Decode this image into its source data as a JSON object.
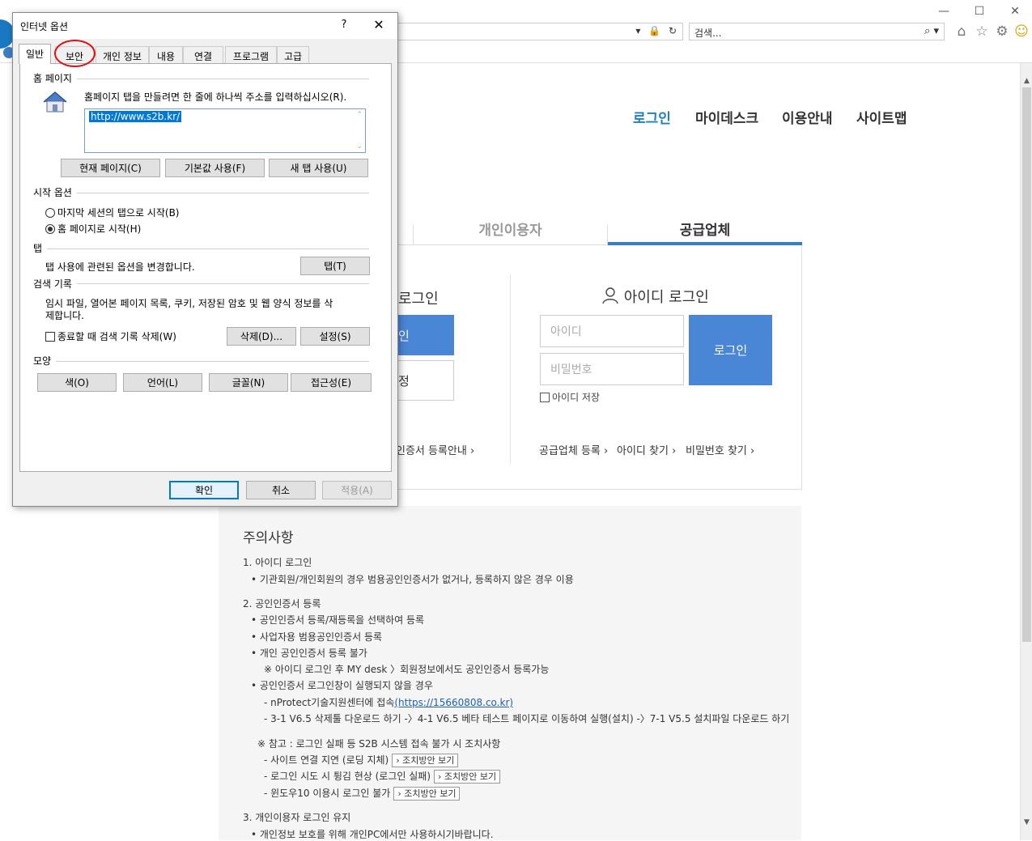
{
  "browser": {
    "window_controls": {
      "minimize": "—",
      "maximize": "☐",
      "close": "✕"
    },
    "address_tools": "▾ 🔒 ↻",
    "search_placeholder": "검색...",
    "search_tools": "⌕ ▾",
    "toolbar_icons": {
      "home": "⌂",
      "favorites": "☆",
      "settings": "⚙",
      "smiley": "☺"
    }
  },
  "page": {
    "nav": [
      "로그인",
      "마이데스크",
      "이용안내",
      "사이트맵"
    ],
    "user_tabs": {
      "personal": "개인이용자",
      "supplier": "공급업체"
    },
    "cert_login": {
      "title_partial": "로그인",
      "login_btn_partial": "인",
      "register_btn_partial": "정",
      "cert_register_link": "인증서 등록안내 ›"
    },
    "id_login": {
      "title": "아이디 로그인",
      "id_placeholder": "아이디",
      "pw_placeholder": "비밀번호",
      "login_button": "로그인",
      "save_id": "아이디 저장",
      "links": [
        "공급업체 등록 ›",
        "아이디 찾기 ›",
        "비밀번호 찾기 ›"
      ]
    },
    "notice": {
      "title": "주의사항",
      "lines": [
        "1. 아이디 로그인",
        "• 기관회원/개인회원의 경우 범용공인인증서가 없거나, 등록하지 않은 경우 이용",
        "2. 공인인증서 등록",
        "• 공인인증서 등록/재등록을 선택하여 등록",
        "• 사업자용 범용공인인증서 등록",
        "• 개인 공인인증서 등록 불가",
        "※ 아이디 로그인 후 MY desk 〉회원정보에서도 공인인증서 등록가능",
        "• 공인인증서 로그인창이 실행되지 않을 경우",
        "- nProtect기술지원센터에 접속",
        "- 3-1 V6.5 삭제툴 다운로드 하기 -〉4-1 V6.5 베타 테스트 페이지로 이동하여 실행(설치) -〉7-1 V5.5 설치파일 다운로드 하기",
        "※ 참고 : 로그인 실패 등 S2B 시스템 접속 불가 시 조치사항",
        "- 사이트 연결 지연 (로딩 지체)",
        "- 로그인 시도 시 튕김 현상 (로그인 실패)",
        "- 윈도우10 이용시 로그인 불가",
        "3. 개인이용자 로그인 유지",
        "• 개인정보 보호를 위해 개인PC에서만 사용하시기바랍니다."
      ],
      "nprotect_link": "(https://15660808.co.kr)",
      "fix_button": "조치방안 보기"
    }
  },
  "dialog": {
    "title": "인터넷 옵션",
    "help": "?",
    "close": "✕",
    "tabs": [
      "일반",
      "보안",
      "개인 정보",
      "내용",
      "연결",
      "프로그램",
      "고급"
    ],
    "home": {
      "group": "홈 페이지",
      "desc": "홈페이지 탭을 만들려면 한 줄에 하나씩 주소를 입력하십시오(R).",
      "url": "http://www.s2b.kr/",
      "btn_current": "현재 페이지(C)",
      "btn_default": "기본값 사용(F)",
      "btn_newtab": "새 탭 사용(U)"
    },
    "startup": {
      "group": "시작 옵션",
      "opt_last": "마지막 세션의 탭으로 시작(B)",
      "opt_home": "홈 페이지로 시작(H)"
    },
    "tabs_group": {
      "group": "탭",
      "desc": "탭 사용에 관련된 옵션을 변경합니다.",
      "btn": "탭(T)"
    },
    "history": {
      "group": "검색 기록",
      "desc1": "임시 파일, 열어본 페이지 목록, 쿠키, 저장된 암호 및 웹 양식 정보를 삭",
      "desc2": "제합니다.",
      "chk": "종료할 때 검색 기록 삭제(W)",
      "btn_delete": "삭제(D)...",
      "btn_settings": "설정(S)"
    },
    "appearance": {
      "group": "모양",
      "btn_color": "색(O)",
      "btn_lang": "언어(L)",
      "btn_font": "글꼴(N)",
      "btn_access": "접근성(E)"
    },
    "footer": {
      "ok": "확인",
      "cancel": "취소",
      "apply": "적용(A)"
    }
  }
}
